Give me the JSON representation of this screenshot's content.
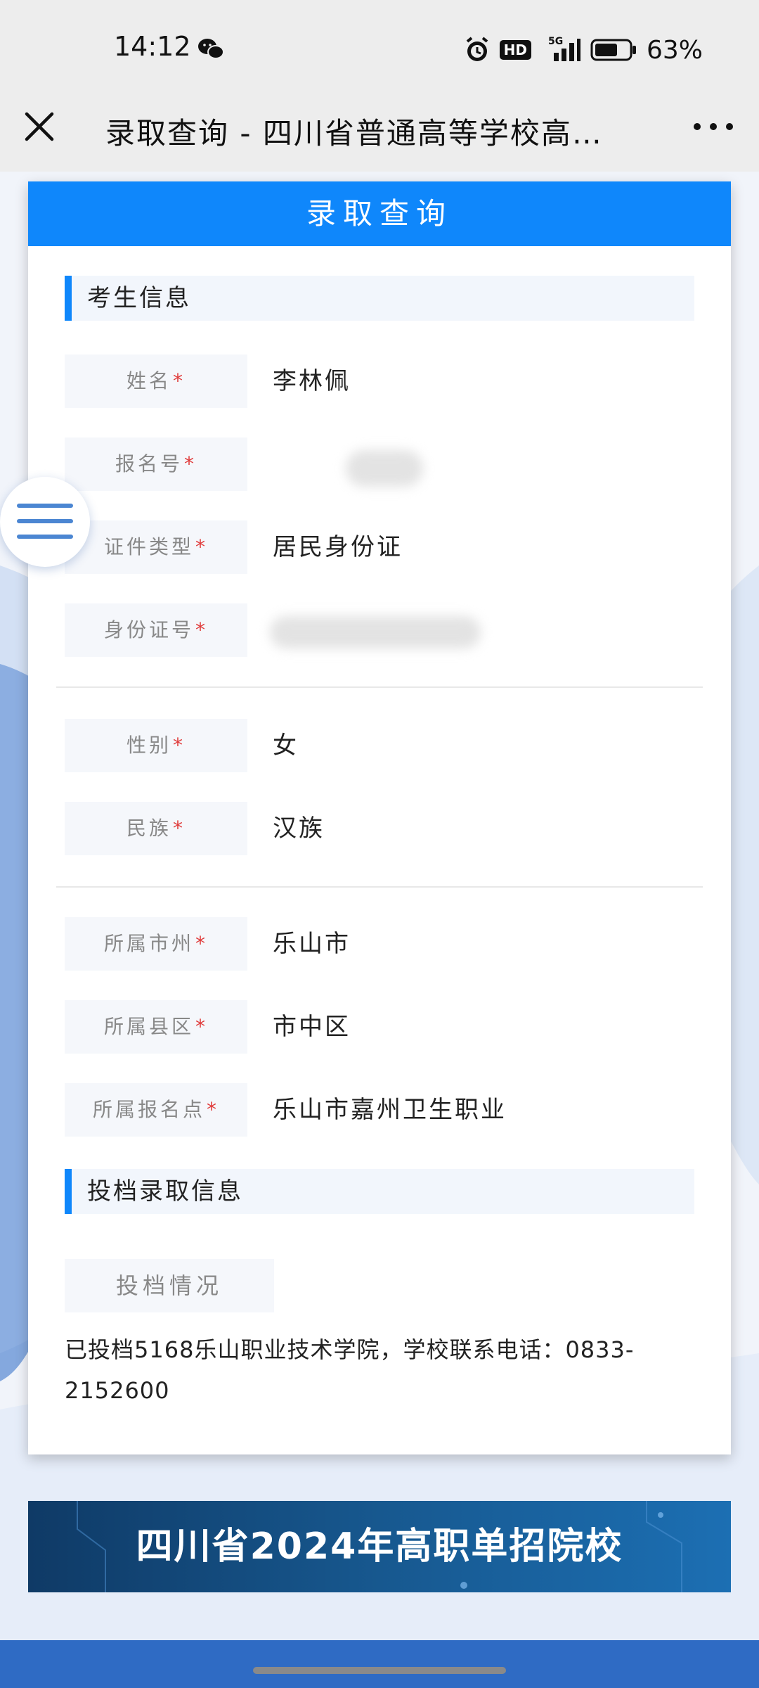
{
  "status_bar": {
    "time": "14:12",
    "hd_badge": "HD",
    "network": "5G",
    "battery_percent": "63%"
  },
  "nav_bar": {
    "title": "录取查询 - 四川省普通高等学校高…"
  },
  "card": {
    "header": "录取查询",
    "section_student": "考生信息",
    "fields_group1": [
      {
        "label": "姓名",
        "value": "李林佩"
      },
      {
        "label": "报名号",
        "value": ""
      },
      {
        "label": "证件类型",
        "value": "居民身份证"
      },
      {
        "label": "身份证号",
        "value": ""
      }
    ],
    "fields_group2": [
      {
        "label": "性别",
        "value": "女"
      },
      {
        "label": "民族",
        "value": "汉族"
      }
    ],
    "fields_group3": [
      {
        "label": "所属市州",
        "value": "乐山市"
      },
      {
        "label": "所属县区",
        "value": "市中区"
      },
      {
        "label": "所属报名点",
        "value": "乐山市嘉州卫生职业"
      }
    ],
    "required_mark": "*",
    "section_admission": "投档录取信息",
    "status_label": "投档情况",
    "status_text": "已投档5168乐山职业技术学院，学校联系电话：0833-2152600"
  },
  "banner": {
    "text": "四川省2024年高职单招院校"
  },
  "colors": {
    "accent": "#0f87fb",
    "required": "#e03c3c"
  }
}
